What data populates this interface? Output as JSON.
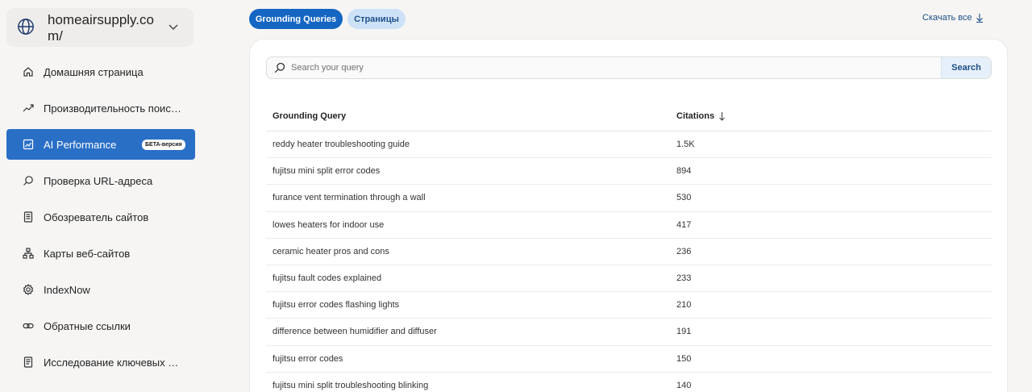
{
  "site": {
    "name": "homeairsupply.com/"
  },
  "sidebar": {
    "items": [
      {
        "label": "Домашняя страница",
        "icon": "home-icon"
      },
      {
        "label": "Производительность поис…",
        "icon": "trending-up-icon"
      },
      {
        "label": "AI Performance",
        "icon": "ai-chart-icon",
        "badge": "БЕТА-версия",
        "active": true
      },
      {
        "label": "Проверка URL-адреса",
        "icon": "search-icon"
      },
      {
        "label": "Обозреватель сайтов",
        "icon": "document-list-icon"
      },
      {
        "label": "Карты веб-сайтов",
        "icon": "sitemap-icon"
      },
      {
        "label": "IndexNow",
        "icon": "gear-icon"
      },
      {
        "label": "Обратные ссылки",
        "icon": "link-icon"
      },
      {
        "label": "Исследование ключевых …",
        "icon": "document-icon"
      }
    ]
  },
  "tabs": {
    "queries": "Grounding Queries",
    "pages": "Страницы"
  },
  "download": {
    "label": "Скачать все"
  },
  "search": {
    "placeholder": "Search your query",
    "button": "Search"
  },
  "table": {
    "headers": {
      "query": "Grounding Query",
      "citations": "Citations"
    },
    "rows": [
      {
        "query": "reddy heater troubleshooting guide",
        "citations": "1.5K"
      },
      {
        "query": "fujitsu mini split error codes",
        "citations": "894"
      },
      {
        "query": "furance vent termination through a wall",
        "citations": "530"
      },
      {
        "query": "lowes heaters for indoor use",
        "citations": "417"
      },
      {
        "query": "ceramic heater pros and cons",
        "citations": "236"
      },
      {
        "query": "fujitsu fault codes explained",
        "citations": "233"
      },
      {
        "query": "fujitsu error codes flashing lights",
        "citations": "210"
      },
      {
        "query": "difference between humidifier and diffuser",
        "citations": "191"
      },
      {
        "query": "fujitsu error codes",
        "citations": "150"
      },
      {
        "query": "fujitsu mini split troubleshooting blinking",
        "citations": "140"
      }
    ]
  },
  "colors": {
    "accent": "#2a6fc6",
    "pill_active": "#1566c2",
    "pill_inactive": "#cde2f7"
  }
}
